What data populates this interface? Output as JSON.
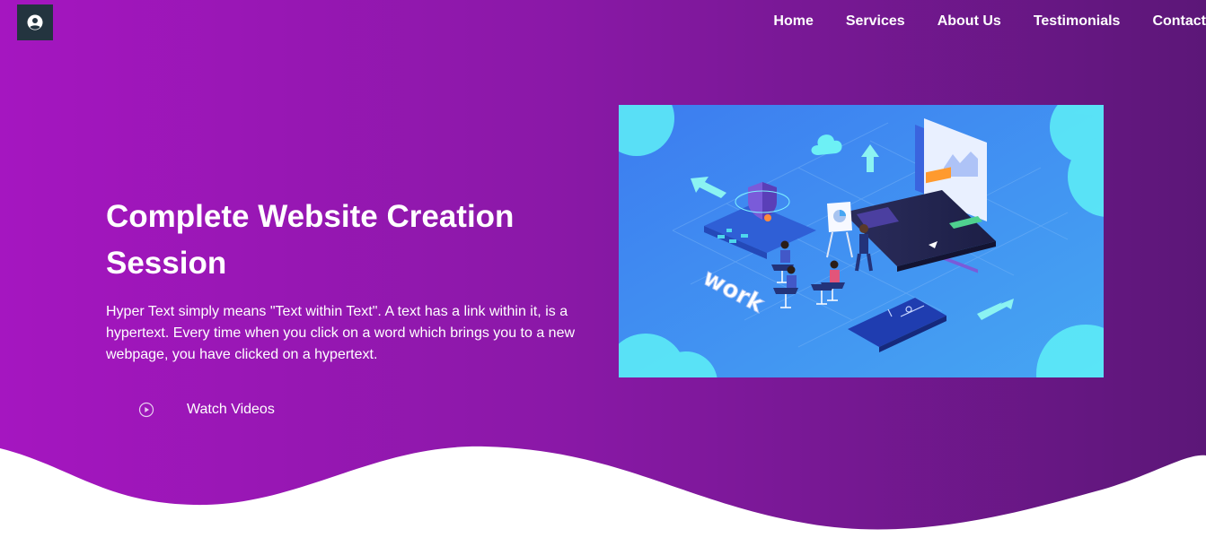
{
  "nav": {
    "items": [
      "Home",
      "Services",
      "About Us",
      "Testimonials",
      "Contact"
    ]
  },
  "hero": {
    "title": "Complete Website Creation Session",
    "description": "Hyper Text simply means \"Text within Text\". A text has a link within it, is a hypertext. Every time when you click on a word which brings you to a new webpage, you have clicked on a hypertext.",
    "watch_label": "Watch Videos",
    "illustration_word": "work"
  },
  "icons": {
    "logo": "user-circle-icon",
    "watch": "play-circle-icon"
  },
  "colors": {
    "gradient_start": "#a516c0",
    "gradient_end": "#5c1778",
    "logo_bg": "#23343f",
    "illustration_bg": "#3f8cf2"
  }
}
